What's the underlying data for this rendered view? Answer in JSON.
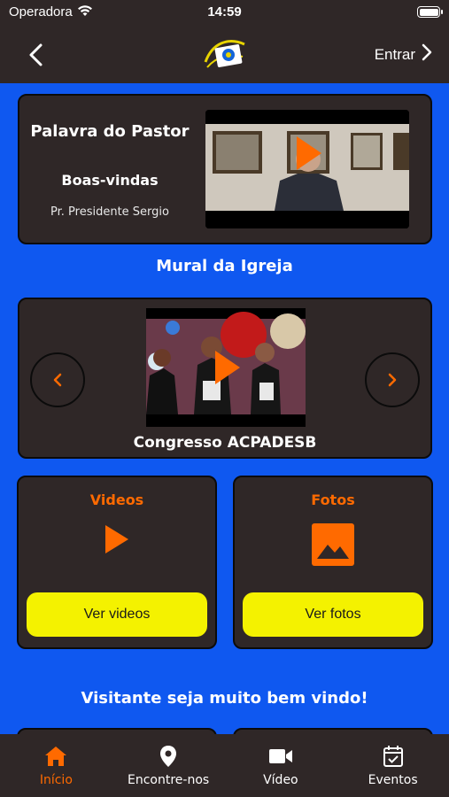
{
  "status_bar": {
    "carrier": "Operadora",
    "time": "14:59"
  },
  "nav": {
    "login_label": "Entrar",
    "logo_icon": "church-logo-icon"
  },
  "pastor": {
    "title": "Palavra do Pastor",
    "subtitle": "Boas-vindas",
    "name": "Pr. Presidente Sergio"
  },
  "mural": {
    "title": "Mural da Igreja"
  },
  "carousel": {
    "caption": "Congresso ACPADESB"
  },
  "tiles": {
    "videos": {
      "title": "Videos",
      "button": "Ver videos",
      "icon": "play-icon"
    },
    "fotos": {
      "title": "Fotos",
      "button": "Ver fotos",
      "icon": "image-icon"
    }
  },
  "welcome": "Visitante seja muito bem vindo!",
  "tabs": [
    {
      "label": "Início",
      "icon": "home-icon",
      "active": true
    },
    {
      "label": "Encontre-nos",
      "icon": "location-pin-icon",
      "active": false
    },
    {
      "label": "Vídeo",
      "icon": "video-camera-icon",
      "active": false
    },
    {
      "label": "Eventos",
      "icon": "calendar-icon",
      "active": false
    }
  ],
  "colors": {
    "background": "#0f58f0",
    "surface": "#2f2727",
    "accent": "#ff6a00",
    "button": "#f4f200"
  }
}
